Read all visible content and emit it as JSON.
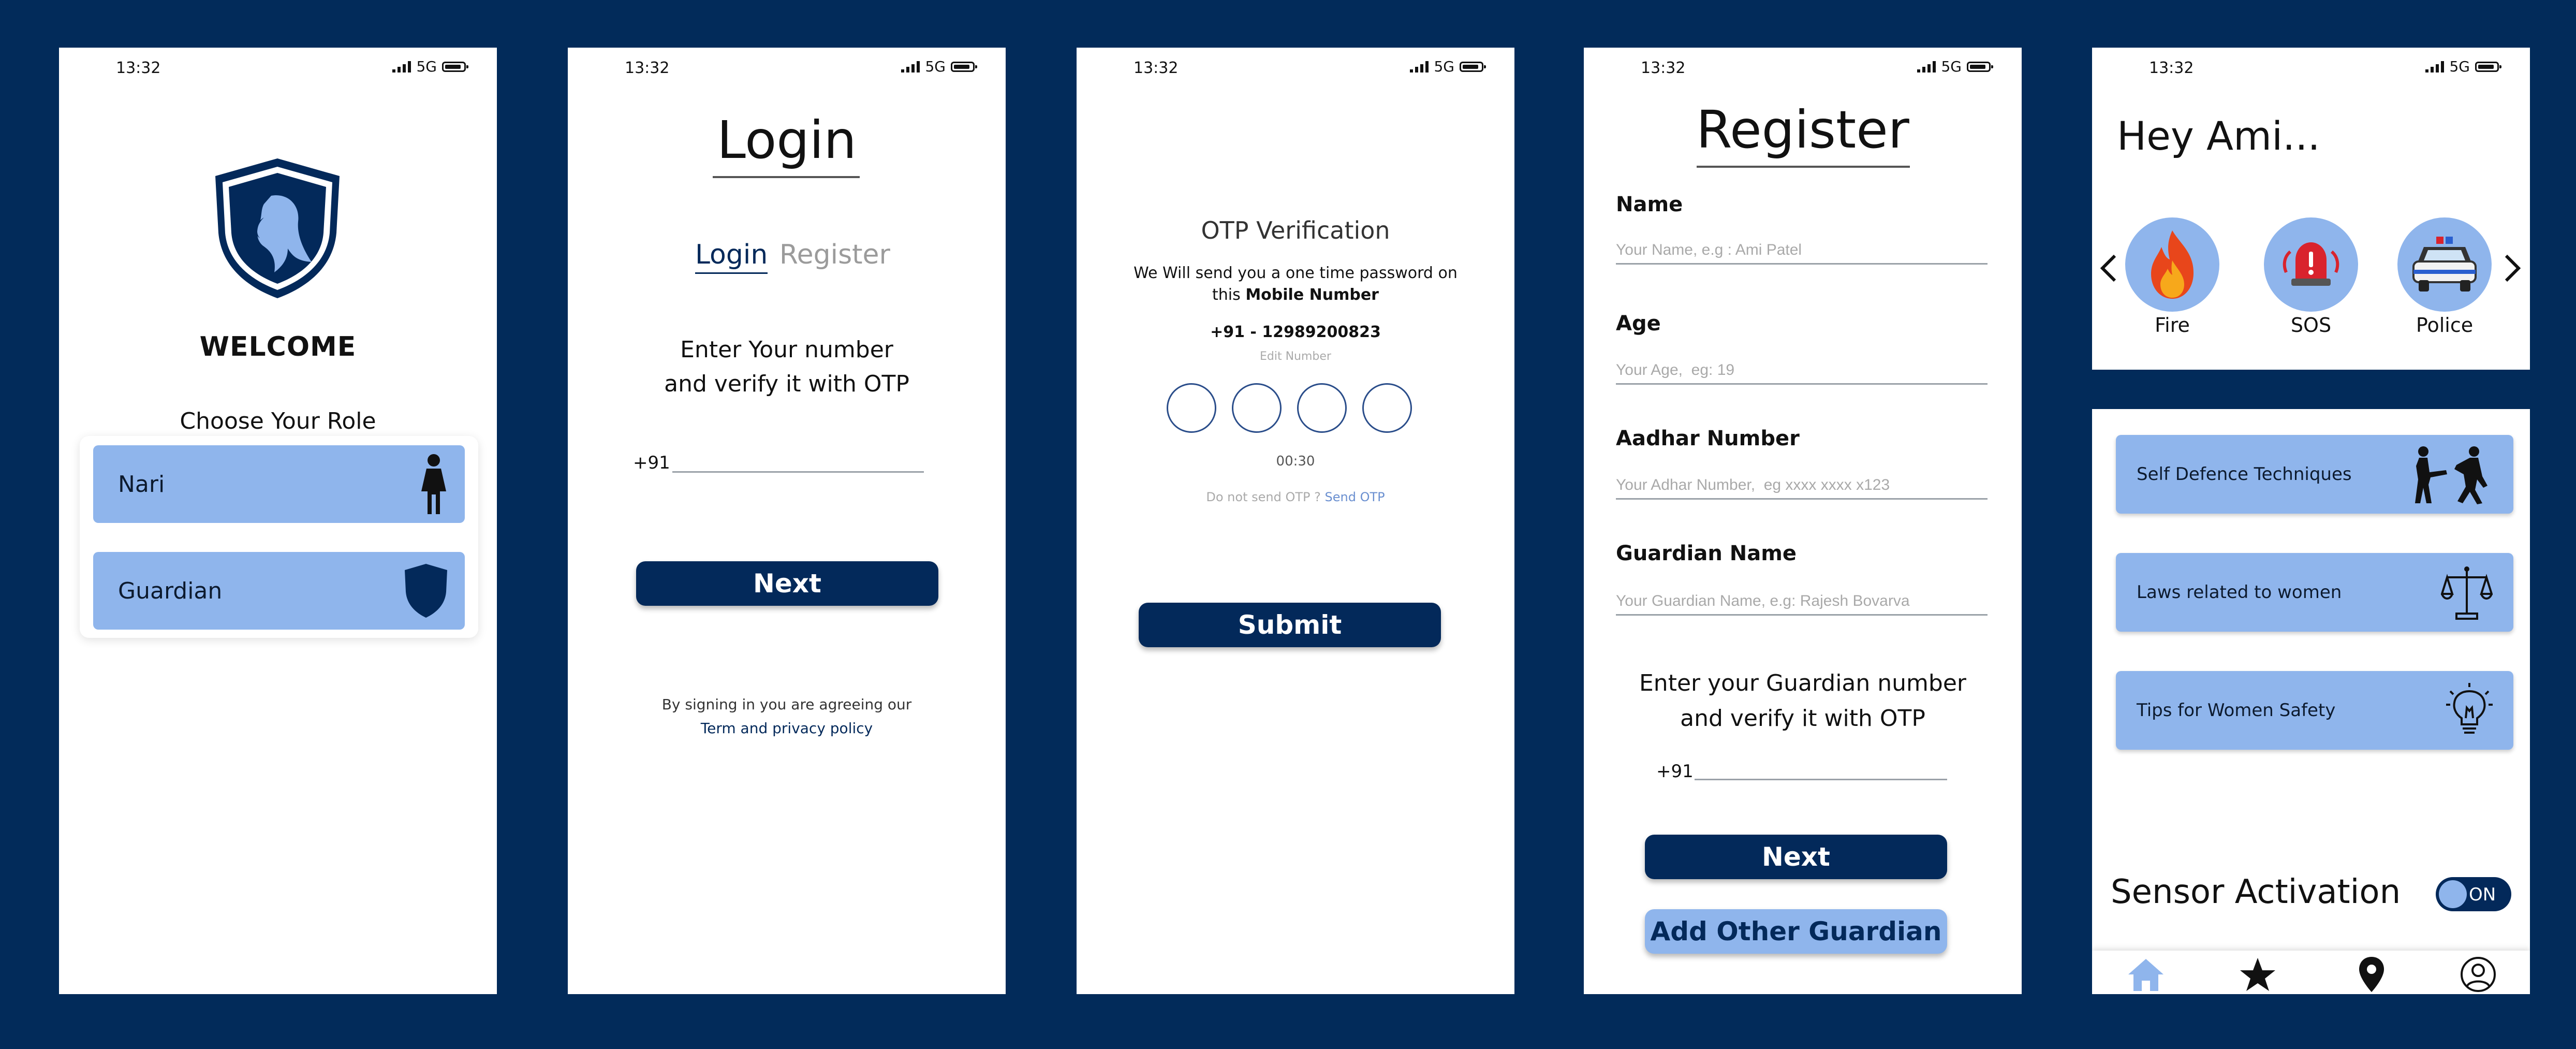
{
  "status": {
    "time": "13:32",
    "network": "5G"
  },
  "screen1": {
    "title": "WELCOME",
    "subtitle": "Choose Your Role",
    "roles": [
      {
        "label": "Nari",
        "icon": "woman-icon"
      },
      {
        "label": "Guardian",
        "icon": "shield-icon"
      }
    ]
  },
  "screen2": {
    "title": "Login",
    "tab_login": "Login",
    "tab_register": "Register",
    "instruction_line1": "Enter Your number",
    "instruction_line2": "and verify it with OTP",
    "country_code": "+91",
    "phone_value": "",
    "next_label": "Next",
    "terms_line1": "By signing in you are agreeing our",
    "terms_link": "Term and privacy policy"
  },
  "screen3": {
    "title": "OTP Verification",
    "desc_line1": "We Will send you a one time password on",
    "desc_line2_prefix": "this",
    "desc_line2_bold": "Mobile Number",
    "phone": "+91 - 12989200823",
    "edit_number": "Edit Number",
    "timer": "00:30",
    "resend_prefix": "Do not send OTP ?",
    "resend_link": "Send OTP",
    "submit_label": "Submit"
  },
  "screen4": {
    "title": "Register",
    "fields": [
      {
        "label": "Name",
        "placeholder": "Your Name, e.g : Ami Patel"
      },
      {
        "label": "Age",
        "placeholder": "Your Age,  eg: 19"
      },
      {
        "label": "Aadhar Number",
        "placeholder": "Your Adhar Number,  eg xxxx xxxx x123"
      },
      {
        "label": "Guardian Name",
        "placeholder": "Your Guardian Name, e.g: Rajesh Bovarva"
      }
    ],
    "instruction_line1": "Enter your Guardian number",
    "instruction_line2": "and verify it with OTP",
    "country_code": "+91",
    "next_label": "Next",
    "add_guardian_label": "Add Other Guardian"
  },
  "screen5": {
    "greeting": "Hey Ami...",
    "services": [
      {
        "label": "Fire",
        "icon": "fire-icon"
      },
      {
        "label": "SOS",
        "icon": "alarm-bell-icon"
      },
      {
        "label": "Police",
        "icon": "police-car-icon"
      }
    ]
  },
  "screen6": {
    "cards": [
      {
        "label": "Self Defence Techniques",
        "icon": "martial-arts-icon"
      },
      {
        "label": "Laws related to women",
        "icon": "scales-icon"
      },
      {
        "label": "Tips for Women Safety",
        "icon": "lightbulb-icon"
      }
    ],
    "sensor_label": "Sensor Activation",
    "toggle_label": "ON",
    "nav": [
      "home-icon",
      "star-icon",
      "location-pin-icon",
      "profile-icon"
    ]
  },
  "colors": {
    "background": "#022b5a",
    "accent_light": "#8fb5ec",
    "button_dark": "#03295a",
    "fire": "#e8461b",
    "sos": "#d9232d"
  }
}
